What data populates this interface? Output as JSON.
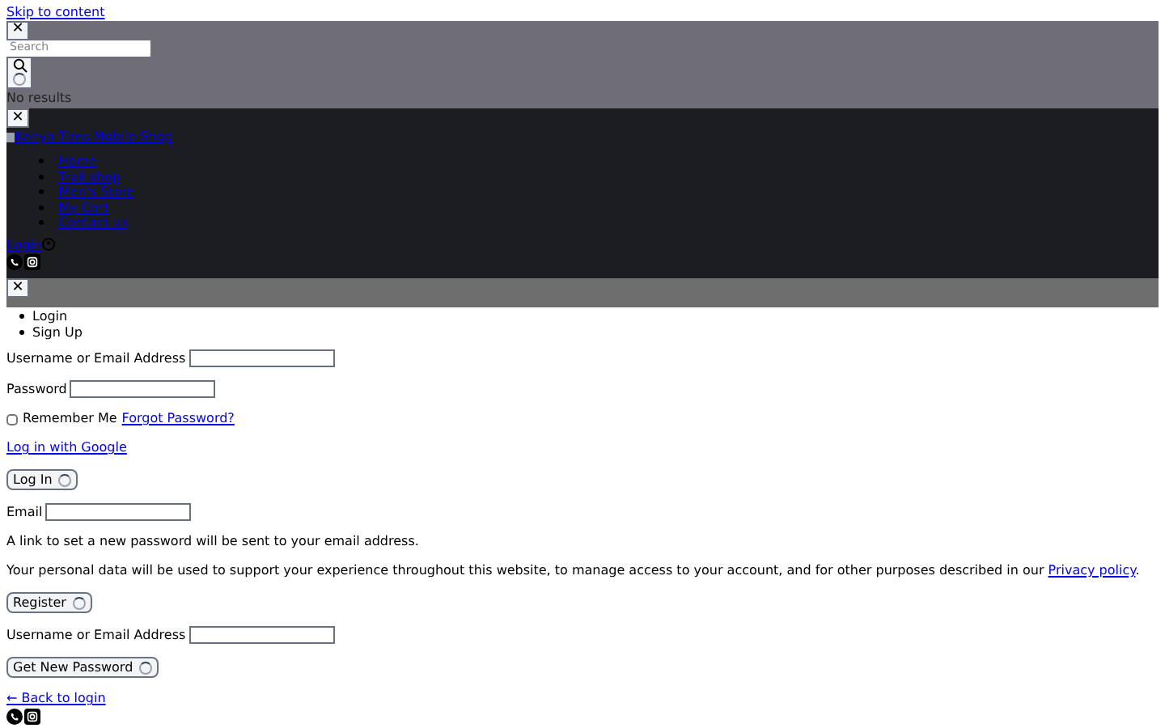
{
  "skip_link": "Skip to content",
  "search_panel": {
    "close": "✕",
    "placeholder": "Search",
    "status": "No results"
  },
  "header": {
    "close": "✕",
    "logo_alt": "Kenya Tires Mobile Shop",
    "nav": [
      "Home",
      "Trail shop",
      "Men's Store",
      "My Cart",
      "Contact us"
    ],
    "login": "Login"
  },
  "account_panel": {
    "close": "✕",
    "tabs": [
      "Login",
      "Sign Up"
    ]
  },
  "login_form": {
    "username_label": "Username or Email Address",
    "password_label": "Password",
    "remember": {
      "label": "Remember Me",
      "checked": false
    },
    "forgot": "Forgot Password?",
    "google": "Log in with Google",
    "submit": "Log In"
  },
  "register_form": {
    "email_label": "Email",
    "note": "A link to set a new password will be sent to your email address.",
    "privacy": "Your personal data will be used to support your experience throughout this website, to manage access to your account, and for other purposes described in our",
    "privacy_link": "Privacy policy",
    "privacy_end": ".",
    "submit": "Register"
  },
  "reset_form": {
    "username_label": "Username or Email Address",
    "submit": "Get New Password",
    "back": "← Back to login"
  }
}
